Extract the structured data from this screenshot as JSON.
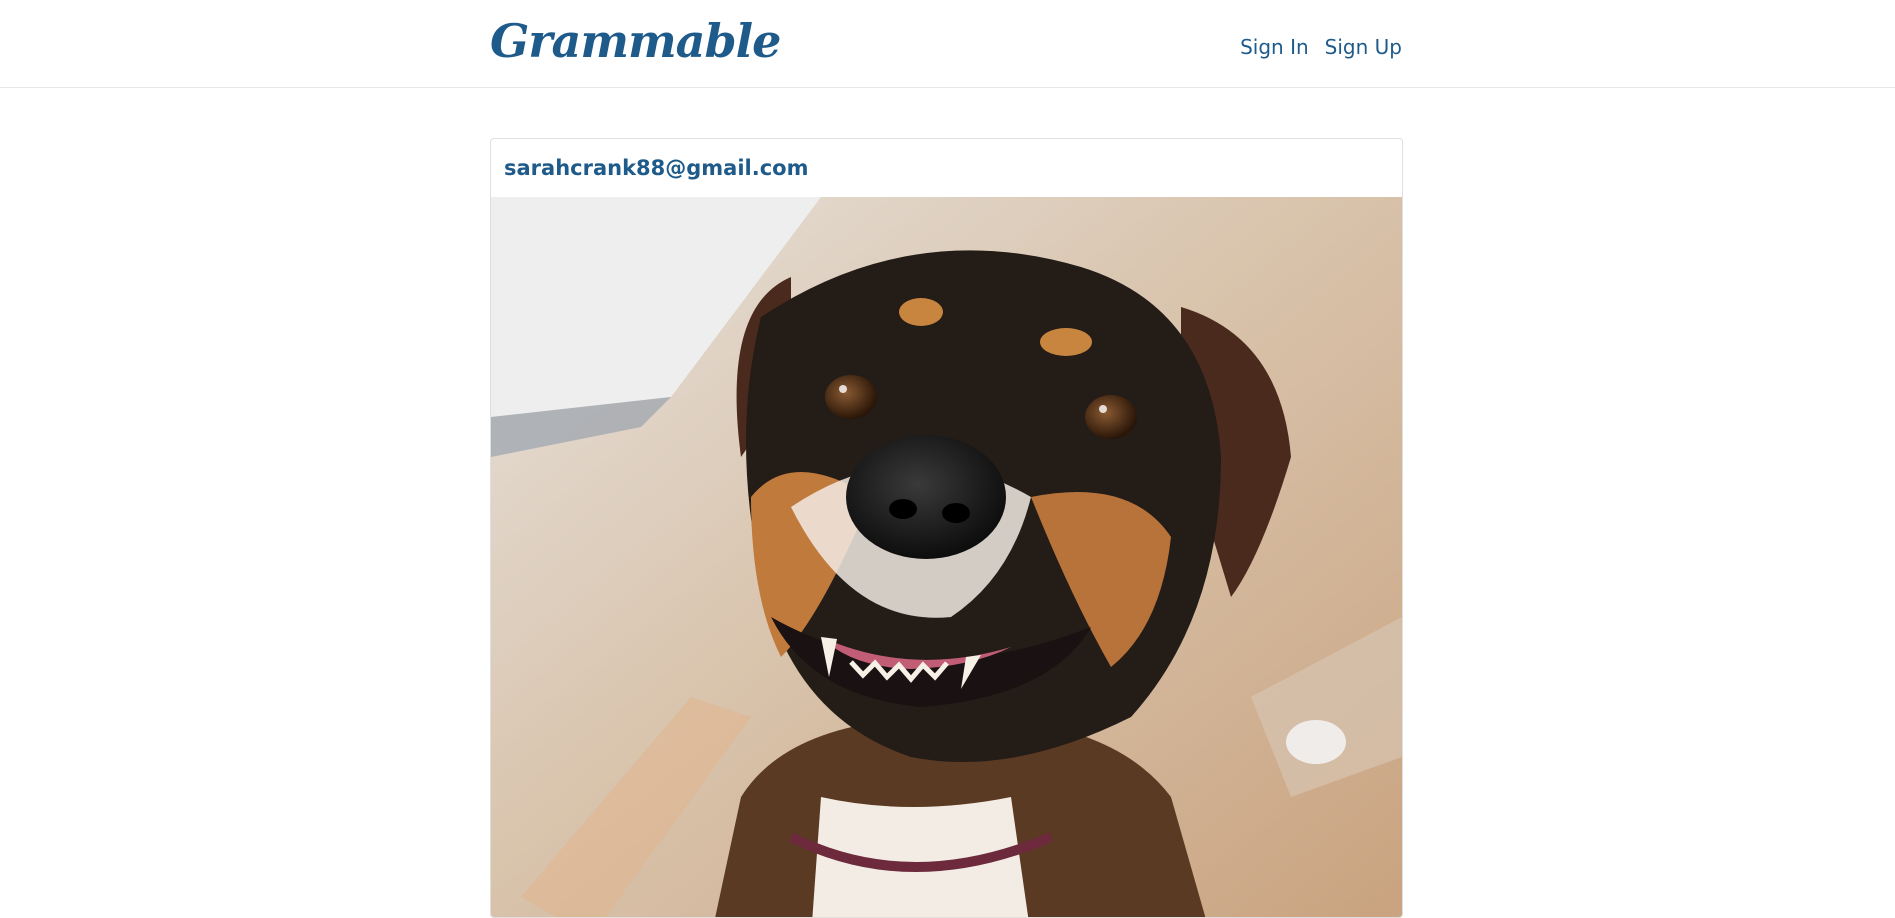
{
  "header": {
    "brand": "Grammable",
    "links": [
      "Sign In",
      "Sign Up"
    ]
  },
  "post": {
    "author": "sarahcrank88@gmail.com",
    "image_subject": "smiling brown and black dog looking up at the camera"
  },
  "colors": {
    "brand": "#1f5b8a",
    "border": "#dfdfdf"
  }
}
